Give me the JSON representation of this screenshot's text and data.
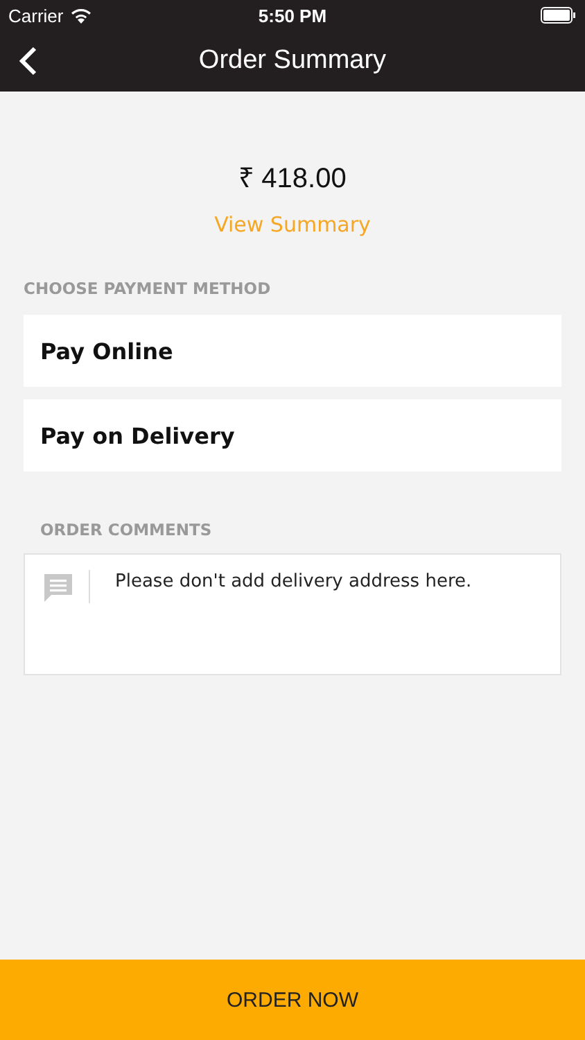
{
  "status_bar": {
    "carrier": "Carrier",
    "time": "5:50 PM"
  },
  "nav": {
    "title": "Order Summary"
  },
  "amount": "₹ 418.00",
  "view_summary": "View Summary",
  "payment": {
    "label": "CHOOSE PAYMENT METHOD",
    "options": [
      {
        "label": "Pay Online"
      },
      {
        "label": "Pay on Delivery"
      }
    ]
  },
  "comments": {
    "label": "ORDER COMMENTS",
    "placeholder": "Please don't add delivery address here."
  },
  "order_button": "ORDER NOW"
}
